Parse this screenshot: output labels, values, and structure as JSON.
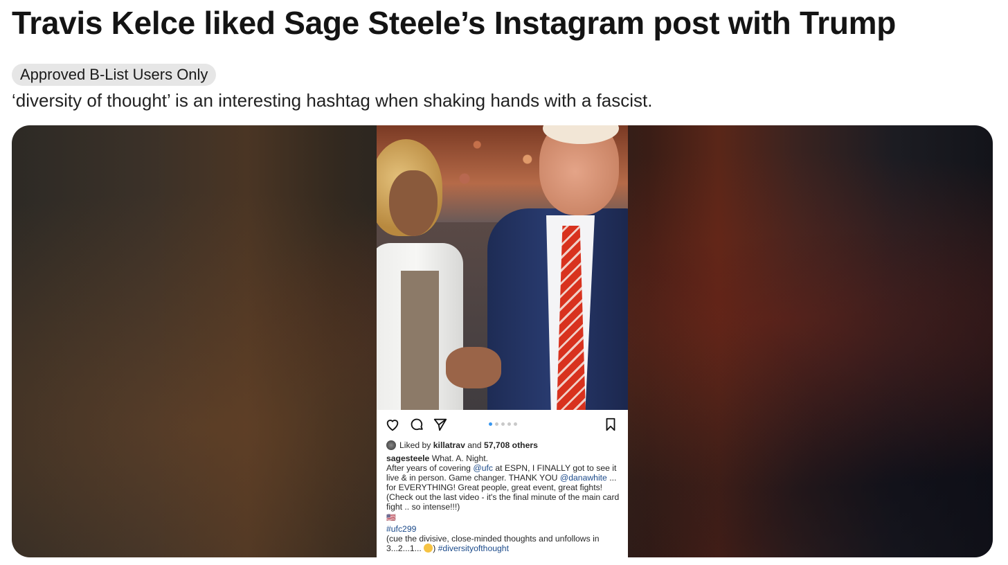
{
  "post": {
    "title": "Travis Kelce liked Sage Steele’s Instagram post with Trump",
    "flair": "Approved B-List Users Only",
    "body": "‘diversity of thought’ is an interesting hashtag when shaking hands with a fascist."
  },
  "instagram": {
    "liked_prefix": "Liked by ",
    "liked_user": "killatrav",
    "liked_and": " and ",
    "liked_count": "57,708 others",
    "username": "sagesteele",
    "caption_title": " What.  A.  Night.",
    "caption_1a": "After years of covering ",
    "mention_ufc": "@ufc",
    "caption_1b": " at ESPN, I FINALLY got to see it live & in person.  Game changer.  THANK YOU ",
    "mention_dana": "@danawhite",
    "caption_1c": " ... for EVERYTHING!  Great people, great event, great fights! (Check out the last video - it's the final minute of the main card fight .. so intense!!!)",
    "flag": "🇺🇸",
    "hashtag_ufc": "#ufc299",
    "caption_2a": "(cue the divisive, close-minded thoughts and unfollows in 3...2...1... ",
    "caption_2b": ") ",
    "hashtag_diversity": "#diversityofthought",
    "carousel_active_color": "#3897f0"
  },
  "icons": [
    "heart-icon",
    "comment-icon",
    "share-icon",
    "bookmark-icon",
    "carousel-dots"
  ]
}
